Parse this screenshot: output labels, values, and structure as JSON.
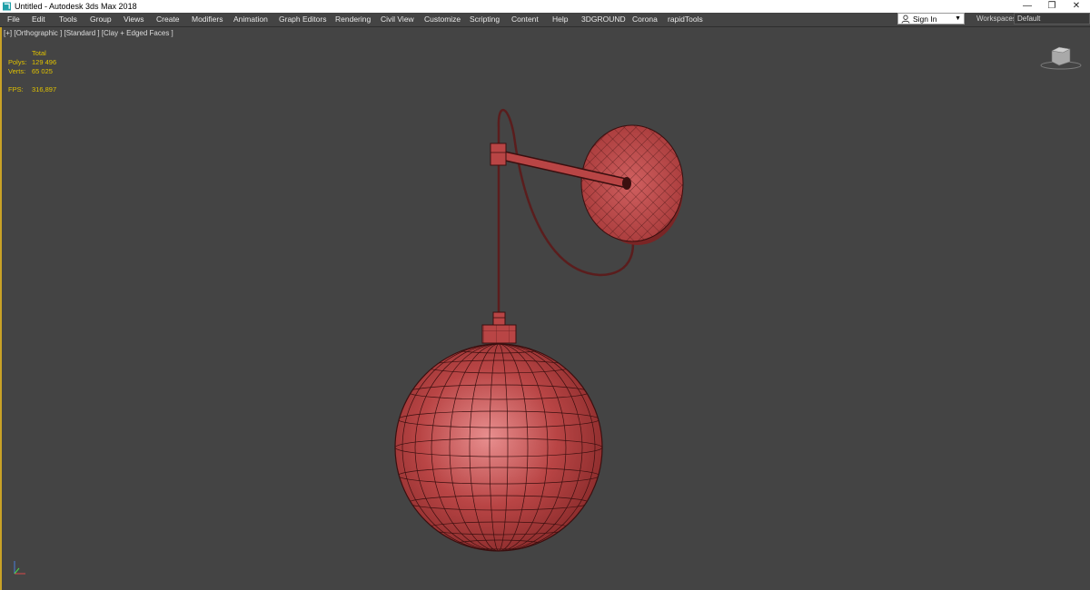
{
  "window": {
    "title": "Untitled - Autodesk 3ds Max 2018",
    "controls": [
      "—",
      "❐",
      "✕"
    ]
  },
  "menu": [
    "File",
    "Edit",
    "Tools",
    "Group",
    "Views",
    "Create",
    "Modifiers",
    "Animation",
    "Graph Editors",
    "Rendering",
    "Civil View",
    "Customize",
    "Scripting",
    "Content",
    "Help",
    "3DGROUND",
    "Corona",
    "rapidTools"
  ],
  "sign_in": {
    "label": "Sign In"
  },
  "workspaces": {
    "label": "Workspaces:",
    "value": "Default"
  },
  "viewport": {
    "label": "[+] [Orthographic ] [Standard ] [Clay + Edged Faces ]",
    "stats": {
      "header": "Total",
      "polys_label": "Polys:",
      "polys_value": "129 496",
      "verts_label": "Verts:",
      "verts_value": "65 025",
      "fps_label": "FPS:",
      "fps_value": "316,897"
    }
  },
  "colors": {
    "model": "#b94545",
    "wire": "#3a0f0f",
    "stats_text": "#e0c200",
    "viewport_bg": "#444444",
    "active_border": "#c9a227"
  },
  "icons": [
    "app-3dsmax-icon",
    "user-icon",
    "dropdown-arrow-icon",
    "viewcube-icon",
    "axis-tripod-icon"
  ]
}
